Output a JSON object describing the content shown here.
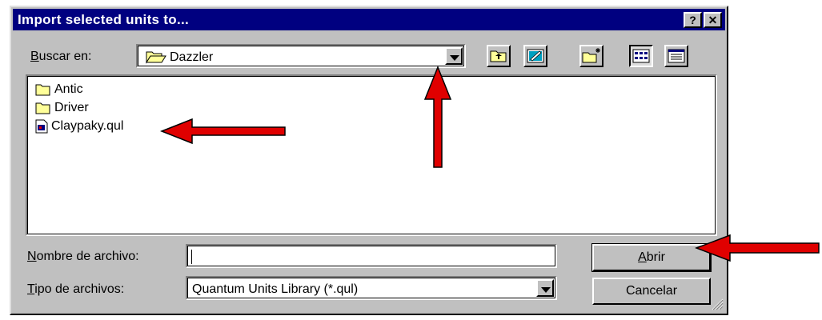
{
  "window": {
    "title": "Import selected units to...",
    "help_glyph": "?",
    "close_glyph": "✕"
  },
  "lookin": {
    "label_accel": "B",
    "label_rest": "uscar en:",
    "value": "Dazzler"
  },
  "toolbar": {
    "buttons": [
      "up-one-level-icon",
      "desktop-icon",
      "new-folder-icon",
      "list-view-icon",
      "details-view-icon"
    ]
  },
  "files": {
    "items": [
      {
        "name": "Antic",
        "type": "folder"
      },
      {
        "name": "Driver",
        "type": "folder"
      },
      {
        "name": "Claypaky.qul",
        "type": "file"
      }
    ]
  },
  "filename": {
    "label_accel": "N",
    "label_rest": "ombre de archivo:",
    "value": ""
  },
  "filetype": {
    "label_accel": "T",
    "label_rest": "ipo de archivos:",
    "value": "Quantum Units Library (*.qul)"
  },
  "buttons": {
    "open_accel": "A",
    "open_rest": "brir",
    "cancel": "Cancelar"
  },
  "colors": {
    "titlebar": "#000080",
    "face": "#c0c0c0",
    "arrow": "#e00000",
    "folder": "#ffff99"
  }
}
